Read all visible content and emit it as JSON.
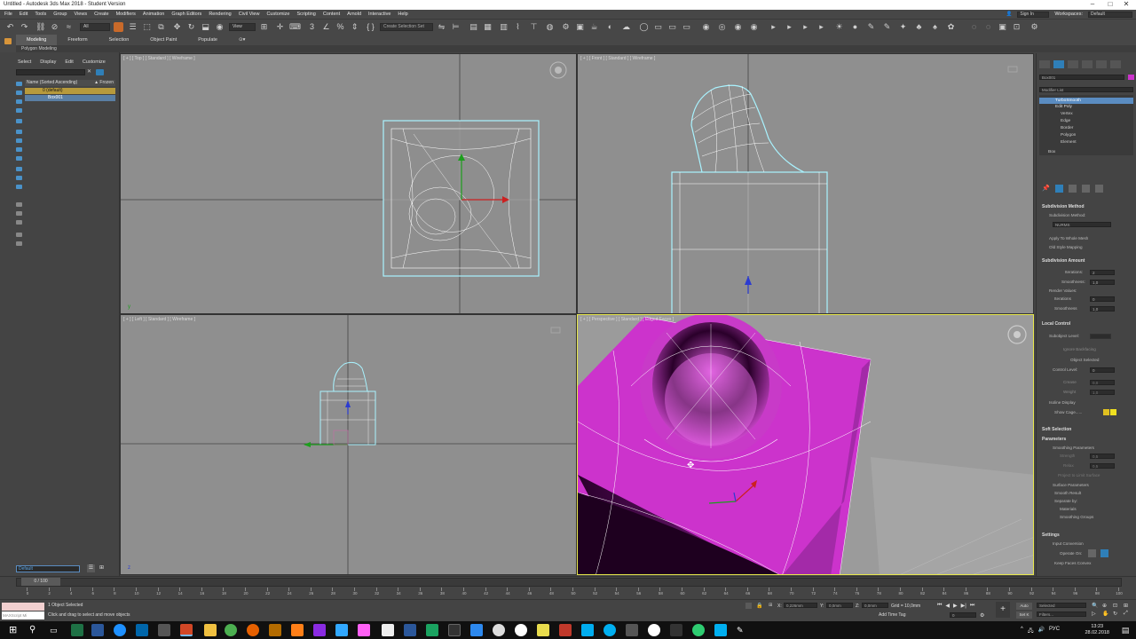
{
  "window": {
    "title": "Untitled - Autodesk 3ds Max 2018 - Student Version",
    "controls": [
      "–",
      "□",
      "✕"
    ]
  },
  "menu": {
    "items": [
      "File",
      "Edit",
      "Tools",
      "Group",
      "Views",
      "Create",
      "Modifiers",
      "Animation",
      "Graph Editors",
      "Rendering",
      "Civil View",
      "Customize",
      "Scripting",
      "Content",
      "Arnold",
      "Interactive",
      "Help"
    ],
    "signin": "Sign In",
    "workspaces_label": "Workspaces:",
    "workspace_value": "Default"
  },
  "toolbar": {
    "filter_value": "All",
    "view_value": "View",
    "selection_set": "Create Selection Set"
  },
  "ribbon": {
    "tabs": [
      "Modeling",
      "Freeform",
      "Selection",
      "Object Paint",
      "Populate"
    ],
    "active": "Modeling",
    "sub_label": "Polygon Modeling"
  },
  "scene_explorer": {
    "tabs": [
      "Select",
      "Display",
      "Edit",
      "Customize"
    ],
    "header": "Name (Sorted Ascending)",
    "header_right": "▲ Frozen",
    "rows": [
      "0 (default)",
      "Box001"
    ],
    "layer_field": "Default"
  },
  "viewports": {
    "top": "[ + ] [ Top ] [ Standard ] [ Wireframe ]",
    "front": "[ + ] [ Front ] [ Standard ] [ Wireframe ]",
    "left": "[ + ] [ Left ] [ Standard ] [ Wireframe ]",
    "perspective": "[ + ] [ Perspective ] [ Standard ] [ Edged Faces ]"
  },
  "command_panel": {
    "object_name": "Box001",
    "modifier_list": "Modifier List",
    "stack": [
      "TurboSmooth",
      "Edit Poly",
      "Vertex",
      "Edge",
      "Border",
      "Polygon",
      "Element",
      "Box"
    ],
    "sections": {
      "subdivision_method": "Subdivision Method",
      "subdivision_method_label": "Subdivision Method:",
      "method_value": "NURMS",
      "apply_whole_mesh": "Apply To Whole Mesh",
      "old_style": "Old Style Mapping",
      "subdivision_amount": "Subdivision Amount",
      "iterations": "Iterations:",
      "iterations_value": "2",
      "smoothness": "Smoothness:",
      "smoothness_value": "1,0",
      "render_values": "Render Values:",
      "r_iterations": "Iterations",
      "r_iterations_value": "0",
      "r_smoothness": "Smoothness",
      "r_smoothness_value": "1,0",
      "local_control": "Local Control",
      "subobject_level": "Subobject Level:",
      "ignore_backfacing": "Ignore Backfacing",
      "object_selected": "Object Selected",
      "control_level": "Control Level:",
      "control_level_value": "0",
      "crease": "Crease",
      "crease_value": "0,0",
      "weight": "Weight",
      "weight_value": "1,0",
      "isoline_display": "Isoline Display",
      "show_cage": "Show Cage......",
      "soft_selection": "Soft Selection",
      "parameters": "Parameters",
      "smoothing_parameters": "Smoothing Parameters",
      "strength": "Strength",
      "strength_value": "0,5",
      "relax": "Relax",
      "relax_value": "0,5",
      "project_limit": "Project to Limit Surface",
      "surface_parameters": "Surface Parameters",
      "smooth_result": "Smooth Result",
      "separate_by": "Separate by:",
      "materials": "Materials",
      "smoothing_groups": "Smoothing Groups",
      "settings": "Settings",
      "input_conversion": "Input Conversion",
      "operate_on": "Operate On:",
      "keep_faces_convex": "Keep Faces Convex"
    }
  },
  "timeline": {
    "frame_display": "0 / 100",
    "ticks": [
      "0",
      "2",
      "4",
      "6",
      "8",
      "10",
      "12",
      "14",
      "16",
      "18",
      "20",
      "22",
      "24",
      "26",
      "28",
      "30",
      "32",
      "34",
      "36",
      "38",
      "40",
      "42",
      "44",
      "46",
      "48",
      "50",
      "52",
      "54",
      "56",
      "58",
      "60",
      "62",
      "64",
      "66",
      "68",
      "70",
      "72",
      "74",
      "76",
      "78",
      "80",
      "82",
      "84",
      "86",
      "88",
      "90",
      "92",
      "94",
      "96",
      "98",
      "100"
    ]
  },
  "status": {
    "maxscript": "MAXScript Mi",
    "message1": "1 Object Selected",
    "message2": "Click and drag to select and move objects",
    "x_label": "X:",
    "x_value": "0,226mm",
    "y_label": "Y:",
    "y_value": "0,0mm",
    "z_label": "Z:",
    "z_value": "0,0mm",
    "grid": "Grid = 10,0mm",
    "add_time_tag": "Add Time Tag",
    "auto": "Auto",
    "set_k": "Set K",
    "selected": "Selected",
    "filters": "Filters...",
    "frame": "0"
  },
  "taskbar": {
    "time": "13:23",
    "date": "28.02.2018",
    "lang": "РУС"
  },
  "colors": {
    "accent_blue": "#2f7fb8",
    "selection_cyan": "#a9f3ff",
    "object_magenta": "#cc33cc",
    "active_viewport": "#e8e84b"
  }
}
